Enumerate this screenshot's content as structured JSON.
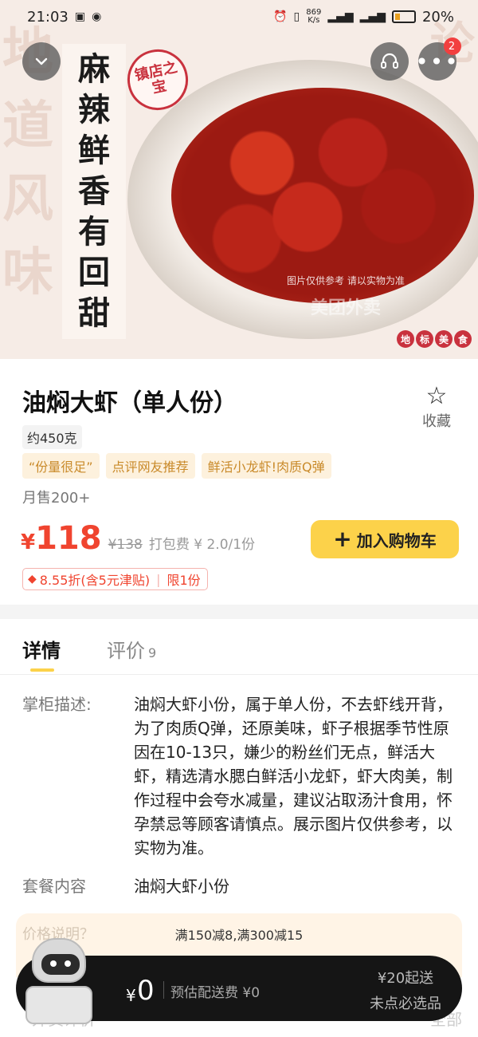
{
  "status_bar": {
    "time": "21:03",
    "net_speed_value": "869",
    "net_speed_unit": "K/s",
    "battery": "20%"
  },
  "hero": {
    "slogan_chars": [
      "麻",
      "辣",
      "鲜",
      "香",
      "有",
      "回",
      "甜"
    ],
    "seal": "镇店之宝",
    "bg_text": "地道风味",
    "bg_text_right": "论",
    "watermark": "图片仅供参考 请以实物为准",
    "watermark_brand": "美团外卖",
    "tag_chars": [
      "地",
      "标",
      "美",
      "食"
    ]
  },
  "toolbar": {
    "more_badge": "2"
  },
  "product": {
    "title": "油焖大虾（单人份）",
    "favorite_label": "收藏",
    "weight": "约450克",
    "tags": [
      "“份量很足”",
      "点评网友推荐",
      "鲜活小龙虾!肉质Q弹"
    ],
    "sales": "月售200+",
    "currency": "¥",
    "price": "118",
    "original_price": "¥138",
    "packing_fee": "打包费 ¥ 2.0/1份",
    "add_to_cart": "加入购物车",
    "discount": "8.55折(含5元津贴)",
    "limit": "限1份"
  },
  "tabs": {
    "details": "详情",
    "reviews": "评价",
    "reviews_count": "9"
  },
  "details": {
    "description_label": "掌柜描述:",
    "description": "油焖大虾小份，属于单人份，不去虾线开背，为了肉质Q弹，还原美味，虾子根据季节性原因在10-13只，嫌少的粉丝们无点，鲜活大虾，精选清水腮白鲜活小龙虾，虾大肉美，制作过程中会夸水减量，建议沾取汤汁食用，怀孕禁忌等顾客请慎点。展示图片仅供参考，以实物为准。",
    "package_label": "套餐内容",
    "package_value": "油焖大虾小份"
  },
  "promo": {
    "ghost_label": "价格说明？",
    "text": "满150减8,满300减15"
  },
  "bottom_bar": {
    "currency": "¥",
    "total": "0",
    "delivery": "预估配送费 ¥0",
    "min_order": "¥20起送",
    "must_select": "未点必选品",
    "ghost_left": "外卖评价",
    "ghost_right": "全部"
  }
}
